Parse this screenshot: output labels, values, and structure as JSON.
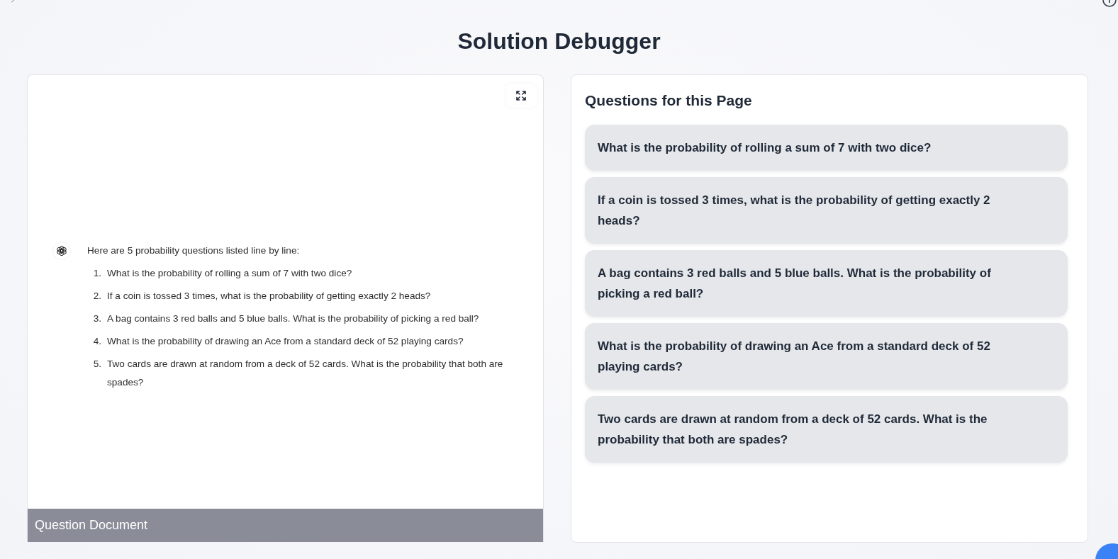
{
  "page": {
    "title": "Solution Debugger"
  },
  "document_panel": {
    "document": {
      "intro": "Here are 5 probability questions listed line by line:",
      "items": [
        {
          "number": "1.",
          "text": "What is the probability of rolling a sum of 7 with two dice?"
        },
        {
          "number": "2.",
          "text": "If a coin is tossed 3 times, what is the probability of getting exactly 2 heads?"
        },
        {
          "number": "3.",
          "text": "A bag contains 3 red balls and 5 blue balls. What is the probability of picking a red ball?"
        },
        {
          "number": "4.",
          "text": "What is the probability of drawing an Ace from a standard deck of 52 playing cards?"
        },
        {
          "number": "5.",
          "text": "Two cards are drawn at random from a deck of 52 cards. What is the probability that both are spades?"
        }
      ]
    },
    "footer": "Question Document"
  },
  "questions_panel": {
    "heading": "Questions for this Page",
    "questions": [
      "What is the probability of rolling a sum of 7 with two dice?",
      "If a coin is tossed 3 times, what is the probability of getting exactly 2 heads?",
      "A bag contains 3 red balls and 5 blue balls. What is the probability of picking a red ball?",
      "What is the probability of drawing an Ace from a standard deck of 52 playing cards?",
      "Two cards are drawn at random from a deck of 52 cards. What is the probability that both are spades?"
    ]
  }
}
